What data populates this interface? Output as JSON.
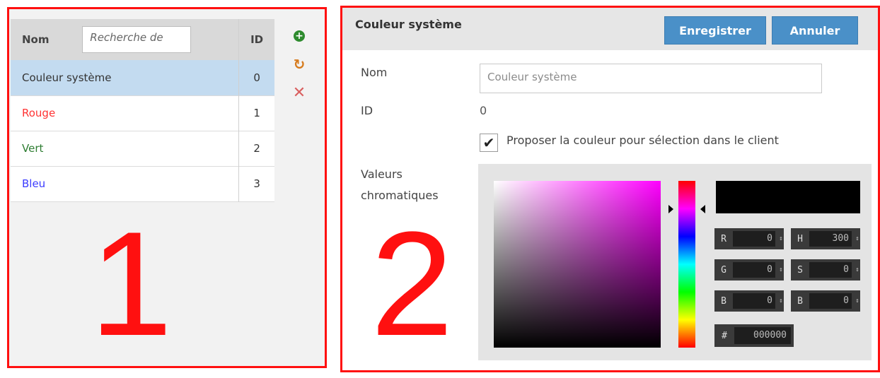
{
  "list_panel": {
    "columns": {
      "name": "Nom",
      "id": "ID"
    },
    "search_placeholder": "Recherche de",
    "rows": [
      {
        "name": "Couleur système",
        "id": "0",
        "color": "#333333",
        "selected": true
      },
      {
        "name": "Rouge",
        "id": "1",
        "color": "#ff3333",
        "selected": false
      },
      {
        "name": "Vert",
        "id": "2",
        "color": "#2e7d32",
        "selected": false
      },
      {
        "name": "Bleu",
        "id": "3",
        "color": "#3b3bff",
        "selected": false
      }
    ],
    "icons": [
      "add-icon",
      "refresh-icon",
      "delete-icon"
    ],
    "annotation": "1"
  },
  "detail_panel": {
    "title": "Couleur système",
    "save_label": "Enregistrer",
    "cancel_label": "Annuler",
    "name_label": "Nom",
    "name_value": "Couleur système",
    "id_label": "ID",
    "id_value": "0",
    "checkbox_label": "Proposer la couleur pour sélection dans le client",
    "checkbox_checked": true,
    "color_values_label_1": "Valeurs",
    "color_values_label_2": "chromatiques",
    "annotation": "2",
    "picker": {
      "R": "0",
      "G": "0",
      "B": "0",
      "H": "300",
      "S": "0",
      "Bv": "0",
      "hex_symbol": "#",
      "hex": "000000",
      "r_label": "R",
      "g_label": "G",
      "b_label": "B",
      "h_label": "H",
      "s_label": "S",
      "bv_label": "B"
    }
  },
  "colors": {
    "accent": "#4a90c8",
    "annotation_red": "#ff1010",
    "selected_row": "#c3dbf0"
  }
}
